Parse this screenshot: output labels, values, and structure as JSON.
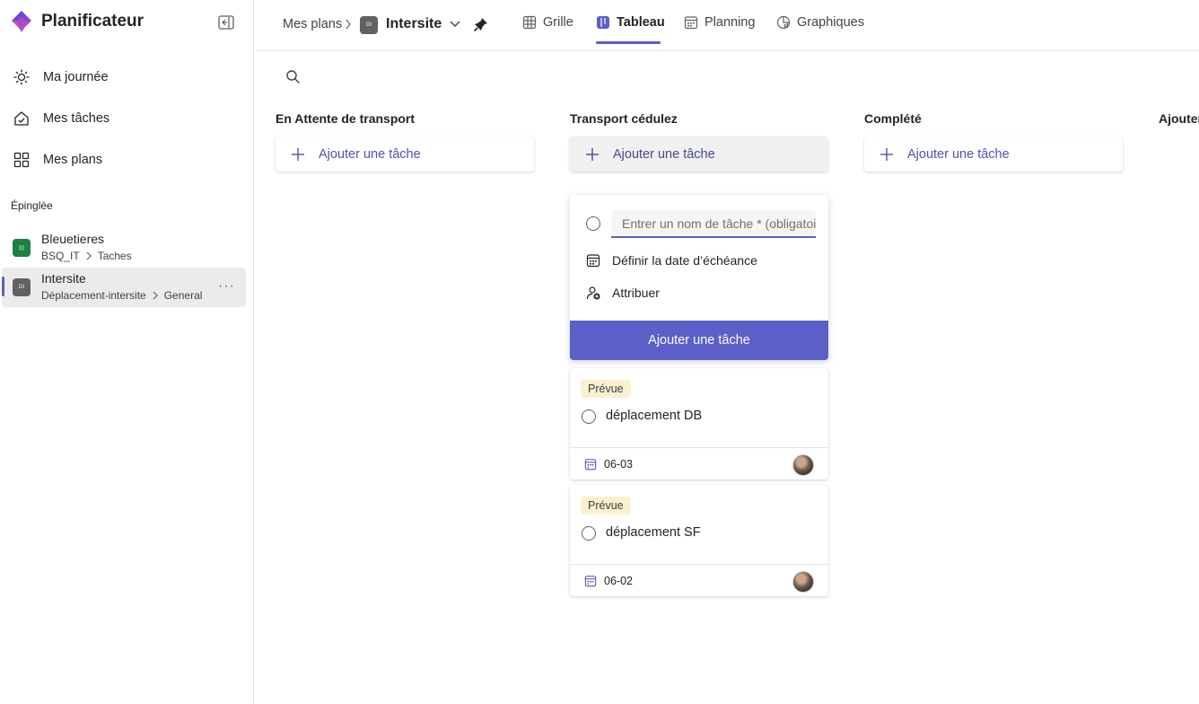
{
  "app": {
    "name": "Planificateur"
  },
  "sidebar": {
    "nav": [
      {
        "label": "Ma journée",
        "icon": "sun-icon"
      },
      {
        "label": "Mes tâches",
        "icon": "home-check-icon"
      },
      {
        "label": "Mes plans",
        "icon": "grid-icon"
      }
    ],
    "pinned_label": "Épinglée",
    "plans": [
      {
        "title": "Bleuetieres",
        "group": "BSQ_IT",
        "channel": "Taches",
        "avatar_color": "#1e7e45",
        "avatar_text": ""
      },
      {
        "title": "Intersite",
        "group": "Déplacement-intersite",
        "channel": "General",
        "avatar_color": "#616161",
        "avatar_text": "DI",
        "more": "···"
      }
    ]
  },
  "header": {
    "root": "Mes plans",
    "plan_icon_text": "DI",
    "plan_title": "Intersite",
    "tabs": [
      {
        "label": "Grille",
        "icon": "grid-table-icon"
      },
      {
        "label": "Tableau",
        "icon": "board-icon",
        "active": true
      },
      {
        "label": "Planning",
        "icon": "calendar-icon"
      },
      {
        "label": "Graphiques",
        "icon": "chart-icon"
      }
    ]
  },
  "board": {
    "columns": [
      {
        "title": "En Attente de transport",
        "add_label": "Ajouter une tâche"
      },
      {
        "title": "Transport cédulez",
        "add_label": "Ajouter une tâche"
      },
      {
        "title": "Complété",
        "add_label": "Ajouter une tâche"
      },
      {
        "title": "Ajouter"
      }
    ],
    "new_task": {
      "placeholder": "Entrer un nom de tâche * (obligatoire)",
      "due_label": "Définir la date d’échéance",
      "assign_label": "Attribuer",
      "submit_label": "Ajouter une tâche"
    },
    "tasks": [
      {
        "badge": "Prévue",
        "name": "déplacement DB",
        "date": "06-03"
      },
      {
        "badge": "Prévue",
        "name": "déplacement SF",
        "date": "06-02"
      }
    ]
  },
  "colors": {
    "accent": "#5b5fc7",
    "badge_bg": "#fbf0cf"
  }
}
